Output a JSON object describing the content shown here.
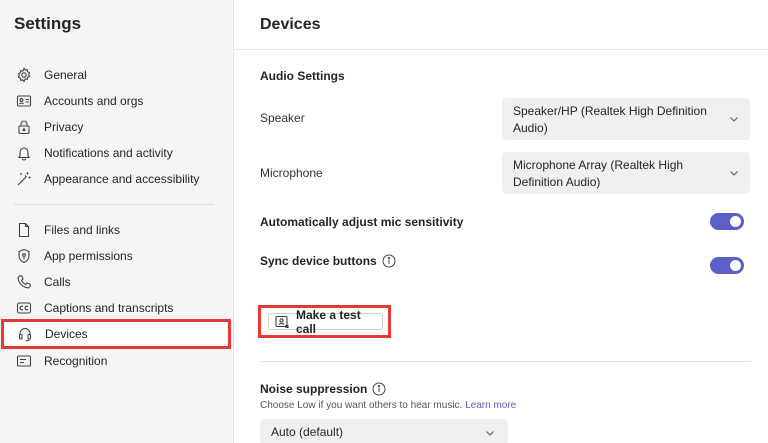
{
  "sidebar": {
    "title": "Settings",
    "group1": [
      {
        "label": "General",
        "icon": "gear-icon"
      },
      {
        "label": "Accounts and orgs",
        "icon": "id-card-icon"
      },
      {
        "label": "Privacy",
        "icon": "lock-icon"
      },
      {
        "label": "Notifications and activity",
        "icon": "bell-icon"
      },
      {
        "label": "Appearance and accessibility",
        "icon": "magic-wand-icon"
      }
    ],
    "group2": [
      {
        "label": "Files and links",
        "icon": "file-icon"
      },
      {
        "label": "App permissions",
        "icon": "shield-icon"
      },
      {
        "label": "Calls",
        "icon": "phone-icon"
      },
      {
        "label": "Captions and transcripts",
        "icon": "closed-caption-icon"
      },
      {
        "label": "Devices",
        "icon": "headset-icon",
        "active": true
      },
      {
        "label": "Recognition",
        "icon": "recognition-icon"
      }
    ]
  },
  "main": {
    "title": "Devices",
    "audio_section_title": "Audio Settings",
    "speaker": {
      "label": "Speaker",
      "value": "Speaker/HP (Realtek High Definition Audio)"
    },
    "microphone": {
      "label": "Microphone",
      "value": "Microphone Array (Realtek High Definition Audio)"
    },
    "auto_adjust": {
      "label": "Automatically adjust mic sensitivity",
      "on": true
    },
    "sync_buttons": {
      "label": "Sync device buttons",
      "on": true
    },
    "test_call_label": "Make a test call",
    "noise": {
      "title": "Noise suppression",
      "description": "Choose Low if you want others to hear music.",
      "learn_more": "Learn more",
      "value": "Auto (default)"
    }
  },
  "colors": {
    "accent": "#5b5fc7",
    "highlight": "#e53935",
    "sidebar_bg": "#f5f5f5"
  }
}
